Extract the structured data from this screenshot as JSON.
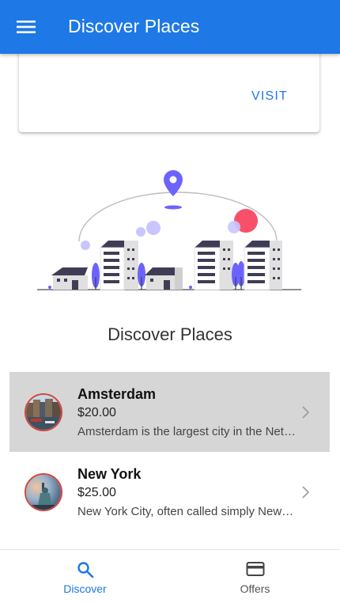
{
  "toolbar": {
    "title": "Discover Places",
    "menu_icon": "menu-icon",
    "background": "#1e78e6"
  },
  "card": {
    "action_label": "VISIT"
  },
  "illustration": {
    "name": "city-skyline-illustration",
    "accent": "#6c63ff",
    "sun": "#f8506a"
  },
  "section": {
    "heading": "Discover Places"
  },
  "places": [
    {
      "name": "Amsterdam",
      "price": "$20.00",
      "description": "Amsterdam is the largest city in the Netherlands",
      "selected": true,
      "thumb_icon": "canal-city-thumbnail"
    },
    {
      "name": "New York",
      "price": "$25.00",
      "description": "New York City, often called simply New York",
      "selected": false,
      "thumb_icon": "statue-of-liberty-thumbnail"
    }
  ],
  "tabs": [
    {
      "label": "Discover",
      "icon": "search-icon",
      "active": true
    },
    {
      "label": "Offers",
      "icon": "card-icon",
      "active": false
    }
  ],
  "colors": {
    "accent": "#1e78e6",
    "selected_row": "#d6d6d6",
    "thumb_border": "#d2473d"
  }
}
